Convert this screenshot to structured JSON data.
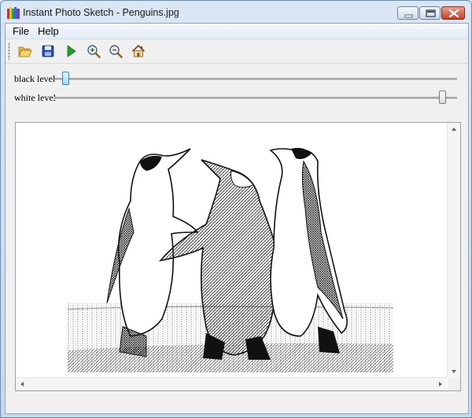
{
  "window": {
    "title": "Instant Photo Sketch - Penguins.jpg"
  },
  "menu": {
    "items": [
      {
        "label": "File"
      },
      {
        "label": "Help"
      }
    ]
  },
  "toolbar": {
    "tools": [
      {
        "icon": "open-folder-icon"
      },
      {
        "icon": "save-disk-icon"
      },
      {
        "icon": "play-icon"
      },
      {
        "icon": "zoom-in-icon"
      },
      {
        "icon": "zoom-out-icon"
      },
      {
        "icon": "home-icon"
      }
    ]
  },
  "sliders": {
    "black_level": {
      "label": "black level",
      "value": 0.03
    },
    "white_level": {
      "label": "white level",
      "value": 0.97
    }
  },
  "image": {
    "subject": "penguins-sketch"
  }
}
